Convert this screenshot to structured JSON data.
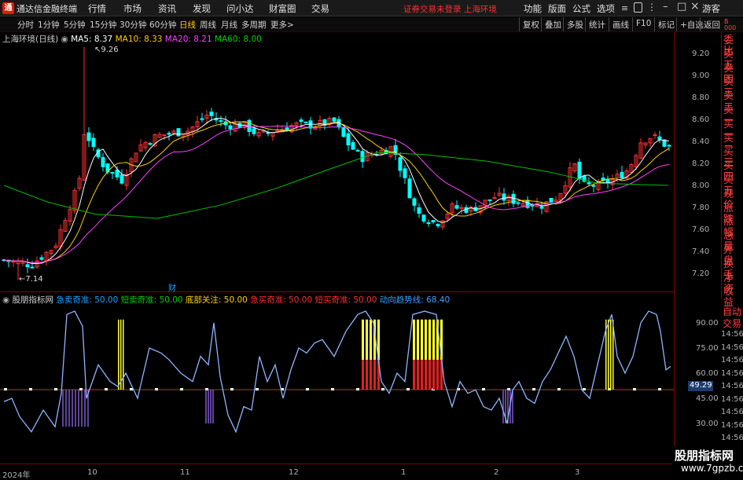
{
  "app": {
    "logo": "通",
    "title": "通达信金融终端"
  },
  "menu": [
    "行情",
    "市场",
    "资讯",
    "发现",
    "问小达",
    "财富圈",
    "交易"
  ],
  "login_status": "证券交易未登录 上海环境",
  "right_menu": [
    "功能",
    "版面",
    "公式",
    "选项"
  ],
  "guest_label": "游客",
  "periods": [
    "分时",
    "1分钟",
    "5分钟",
    "15分钟",
    "30分钟",
    "60分钟",
    "日线",
    "周线",
    "月线",
    "多周期",
    "更多>"
  ],
  "active_period": "日线",
  "toolbar_buttons": [
    "复权",
    "叠加",
    "多股",
    "统计",
    "画线",
    "F10",
    "标记",
    "+自选",
    "返回"
  ],
  "stock_title": "上海环境(日线)",
  "ma": [
    {
      "label": "MA5: 8.37",
      "color": "#ffffff"
    },
    {
      "label": "MA10: 8.33",
      "color": "#ffd000"
    },
    {
      "label": "MA20: 8.21",
      "color": "#ff40ff"
    },
    {
      "label": "MA60: 8.00",
      "color": "#00d000"
    }
  ],
  "high_label": "9.26",
  "low_label": "7.14",
  "event_marker": "财",
  "price_ticks": [
    "9.20",
    "9.00",
    "8.80",
    "8.60",
    "8.40",
    "8.20",
    "8.00",
    "7.80",
    "7.60",
    "7.40",
    "7.20"
  ],
  "order_panel": [
    "委比",
    "卖五",
    "卖四",
    "卖三",
    "卖二",
    "卖一",
    "买一",
    "买二",
    "买三",
    "买四",
    "买五",
    "现价",
    "涨跌",
    "涨幅",
    "总量",
    "外盘",
    "换手",
    "净资",
    "收益"
  ],
  "panel_top_right": "B\n000",
  "indicator": {
    "name": "股朋指标网",
    "items": [
      {
        "label": "急卖奇准: 50.00",
        "color": "#20a0ff"
      },
      {
        "label": "短卖奇准: 50.00",
        "color": "#00d000"
      },
      {
        "label": "底部关注: 50.00",
        "color": "#ffd000"
      },
      {
        "label": "急买奇准: 50.00",
        "color": "#ff3030"
      },
      {
        "label": "短买奇准: 50.00",
        "color": "#ff3030"
      },
      {
        "label": "动向趋势线: 68.40",
        "color": "#40a0ff"
      }
    ],
    "current_value": "49.29",
    "ticks": [
      "90.00",
      "75.00",
      "60.00",
      "45.00",
      "30.00"
    ],
    "right_ticks": [
      "14:56",
      "14:56",
      "14:56",
      "14:56",
      "14:56",
      "14:56",
      "14:56",
      "14:56",
      "14:56"
    ],
    "side_labels": [
      "自动",
      "交易"
    ]
  },
  "dates": [
    "2024年",
    "10",
    "11",
    "12",
    "1",
    "2",
    "3"
  ],
  "watermark": {
    "line1": "股朋指标网",
    "line2": "www.7gpzb.com"
  },
  "colors": {
    "up": "#ff3232",
    "down": "#00ffff",
    "ma5": "#ffffff",
    "ma10": "#ffd000",
    "ma20": "#ff40ff",
    "ma60": "#00c000",
    "osc": "#8fb4ff"
  }
}
